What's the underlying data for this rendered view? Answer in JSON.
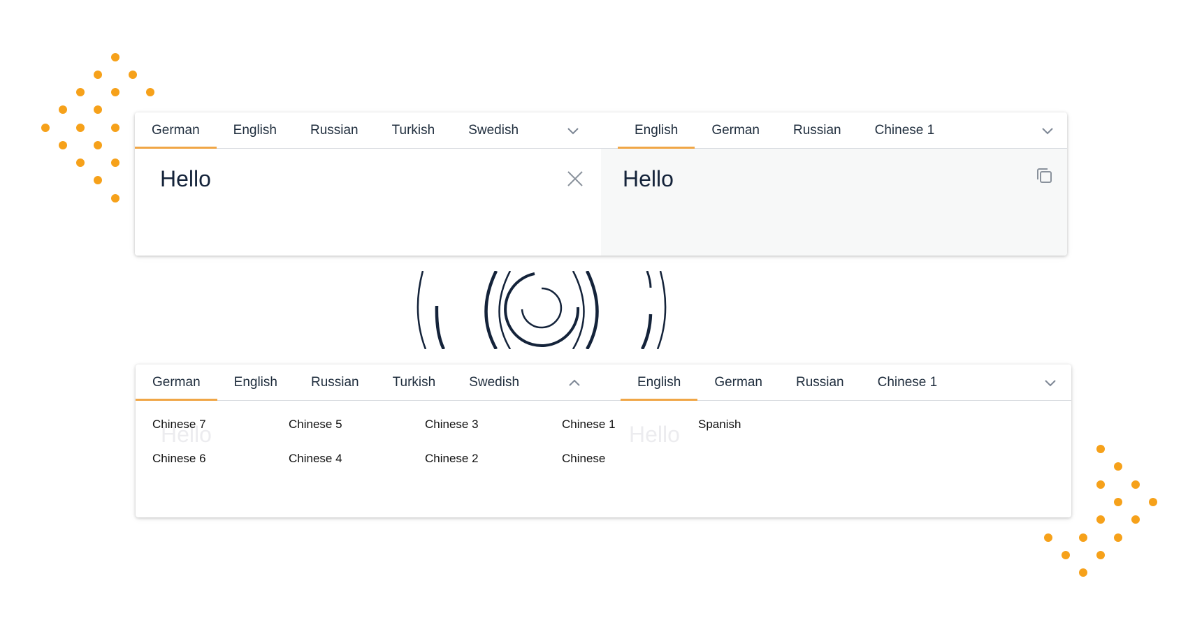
{
  "colors": {
    "accent": "#f0a646",
    "dots": "#f6a11a",
    "text": "#14233a",
    "output_bg": "#f7f8f8"
  },
  "top_panel": {
    "source_tabs": [
      {
        "label": "German",
        "active": true
      },
      {
        "label": "English",
        "active": false
      },
      {
        "label": "Russian",
        "active": false
      },
      {
        "label": "Turkish",
        "active": false
      },
      {
        "label": "Swedish",
        "active": false
      }
    ],
    "target_tabs": [
      {
        "label": "English",
        "active": true
      },
      {
        "label": "German",
        "active": false
      },
      {
        "label": "Russian",
        "active": false
      },
      {
        "label": "Chinese 1",
        "active": false
      }
    ],
    "source_text": "Hello",
    "target_text": "Hello",
    "source_more_icon": "chevron-down-icon",
    "target_more_icon": "chevron-down-icon",
    "clear_icon": "close-icon",
    "copy_icon": "copy-icon"
  },
  "voice_icon": "sound-wave-icon",
  "bottom_panel": {
    "source_tabs": [
      {
        "label": "German",
        "active": true
      },
      {
        "label": "English",
        "active": false
      },
      {
        "label": "Russian",
        "active": false
      },
      {
        "label": "Turkish",
        "active": false
      },
      {
        "label": "Swedish",
        "active": false
      }
    ],
    "target_tabs": [
      {
        "label": "English",
        "active": true
      },
      {
        "label": "German",
        "active": false
      },
      {
        "label": "Russian",
        "active": false
      },
      {
        "label": "Chinese 1",
        "active": false
      }
    ],
    "source_more_icon": "chevron-up-icon",
    "target_more_icon": "chevron-down-icon",
    "language_options": [
      [
        "Chinese 7",
        "Chinese 6"
      ],
      [
        "Chinese 5",
        "Chinese 4"
      ],
      [
        "Chinese 3",
        "Chinese 2"
      ],
      [
        "Chinese 1",
        "Chinese"
      ],
      [
        "Spanish"
      ]
    ],
    "ghost_source_text": "Hello",
    "ghost_target_text": "Hello"
  }
}
